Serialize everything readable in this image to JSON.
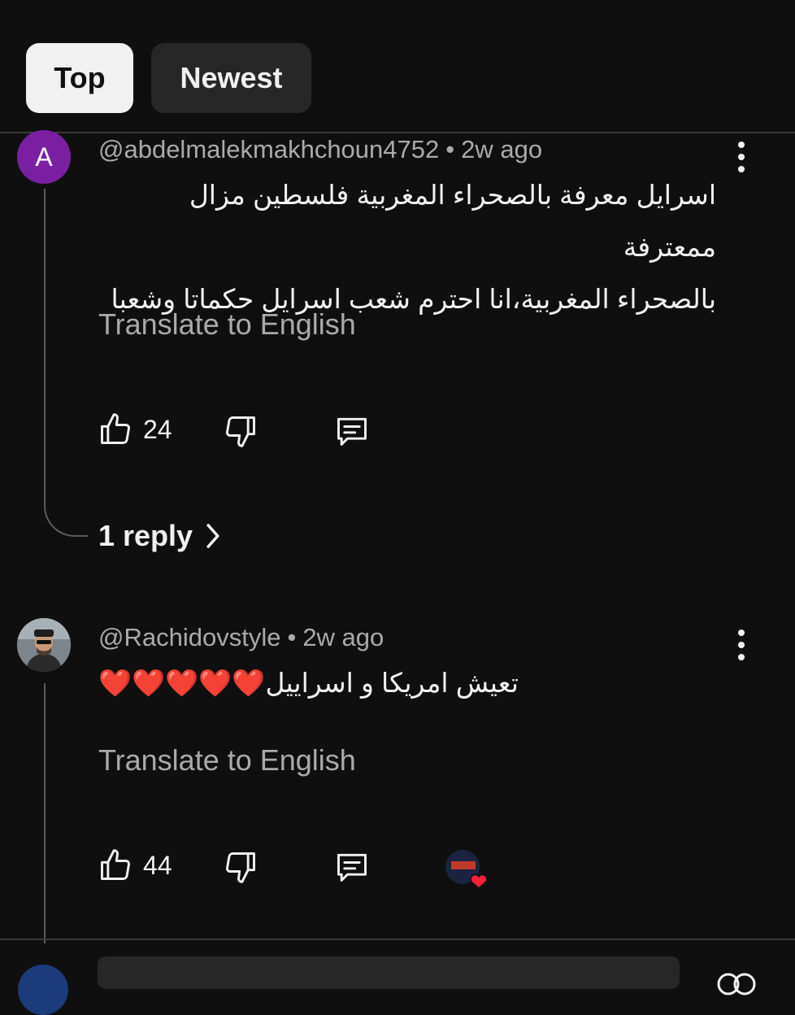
{
  "sort_chips": {
    "top_label": "Top",
    "newest_label": "Newest"
  },
  "comments": [
    {
      "avatar_letter": "A",
      "author": "@abdelmalekmakhchoun4752",
      "time": "2w ago",
      "text_line1": "اسرايل معرفة بالصحراء المغربية فلسطين مزال ممعترفة",
      "text_line2": "بالصحراء المغربية،انا احترم شعب اسرايل حكماتا وشعبا",
      "translate_label": "Translate to English",
      "likes": "24",
      "reply_label": "1 reply"
    },
    {
      "author": "@Rachidovstyle",
      "time": "2w ago",
      "text": "تعيش امريكا و اسراييل",
      "hearts": "❤️❤️❤️❤️❤️",
      "translate_label": "Translate to English",
      "likes": "44"
    }
  ],
  "meta_separator": "•",
  "colors": {
    "background": "#0f0f0f",
    "chip_active": "#f1f1f1",
    "chip_inactive": "#272727",
    "secondary_text": "#aaaaaa",
    "heart": "#e53935",
    "avatar_a": "#7b1fa2"
  },
  "icons": [
    "like-icon",
    "dislike-icon",
    "reply-comment-icon",
    "more-vert-icon",
    "chevron-right-icon",
    "creator-heart-icon"
  ]
}
